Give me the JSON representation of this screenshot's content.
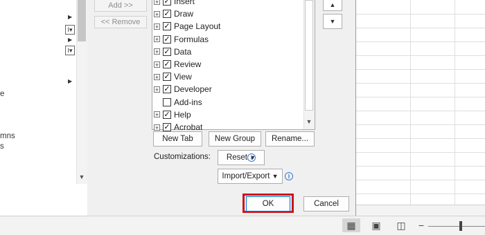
{
  "left_panel": {
    "partial_labels": [
      "e",
      "mns",
      "s"
    ]
  },
  "buttons": {
    "add": "Add >>",
    "remove": "<< Remove",
    "new_tab": "New Tab",
    "new_group": "New Group",
    "rename": "Rename...",
    "reset": "Reset",
    "import_export": "Import/Export",
    "ok": "OK",
    "cancel": "Cancel"
  },
  "labels": {
    "customizations": "Customizations:"
  },
  "tabs": [
    {
      "label": "Insert",
      "checked": true,
      "expandable": true
    },
    {
      "label": "Draw",
      "checked": true,
      "expandable": true
    },
    {
      "label": "Page Layout",
      "checked": true,
      "expandable": true
    },
    {
      "label": "Formulas",
      "checked": true,
      "expandable": true
    },
    {
      "label": "Data",
      "checked": true,
      "expandable": true
    },
    {
      "label": "Review",
      "checked": true,
      "expandable": true
    },
    {
      "label": "View",
      "checked": true,
      "expandable": true
    },
    {
      "label": "Developer",
      "checked": true,
      "expandable": true
    },
    {
      "label": "Add-ins",
      "checked": false,
      "expandable": false
    },
    {
      "label": "Help",
      "checked": true,
      "expandable": true
    },
    {
      "label": "Acrobat",
      "checked": true,
      "expandable": true
    }
  ],
  "colors": {
    "highlight": "#d0121b",
    "dialog_bg": "#f0f0f0",
    "ok_border": "#0078d7",
    "info_blue": "#3a7bd5"
  },
  "icons": {
    "move_up": "triangle-up",
    "move_down": "triangle-down",
    "view_normal": "grid",
    "view_page_layout": "page",
    "view_page_break": "page-break"
  }
}
